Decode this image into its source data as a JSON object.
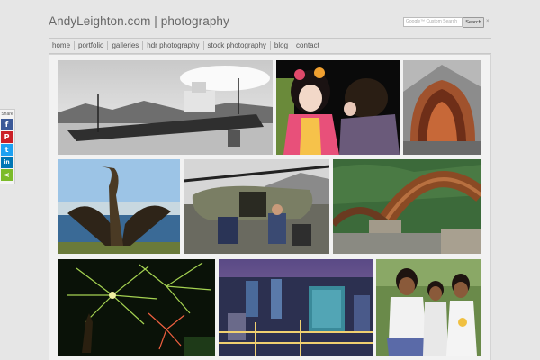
{
  "site": {
    "title": "AndyLeighton.com | photography"
  },
  "search": {
    "placeholder": "Google™ Custom Search",
    "button": "Search",
    "clear": "×"
  },
  "nav": {
    "items": [
      {
        "label": "home"
      },
      {
        "label": "portfolio"
      },
      {
        "label": "galleries"
      },
      {
        "label": "hdr photography"
      },
      {
        "label": "stock photography"
      },
      {
        "label": "blog"
      },
      {
        "label": "contact"
      }
    ]
  },
  "share": {
    "label": "Share",
    "buttons": [
      {
        "glyph": "f",
        "color": "#3b5998",
        "icon": "facebook-icon"
      },
      {
        "glyph": "P",
        "color": "#cb2027",
        "icon": "pinterest-icon"
      },
      {
        "glyph": "t",
        "color": "#1da1f2",
        "icon": "twitter-icon"
      },
      {
        "glyph": "in",
        "color": "#0077b5",
        "icon": "linkedin-icon"
      },
      {
        "glyph": "<",
        "color": "#7cbb2a",
        "icon": "share-icon"
      }
    ]
  },
  "gallery": {
    "photos": [
      {
        "subject": "shipwreck"
      },
      {
        "subject": "kimono-girls"
      },
      {
        "subject": "wooden-arch-vault"
      },
      {
        "subject": "cormorant"
      },
      {
        "subject": "helicopter"
      },
      {
        "subject": "wooden-arch-bridge"
      },
      {
        "subject": "fireworks"
      },
      {
        "subject": "city-at-dusk"
      },
      {
        "subject": "schoolgirls"
      }
    ]
  }
}
